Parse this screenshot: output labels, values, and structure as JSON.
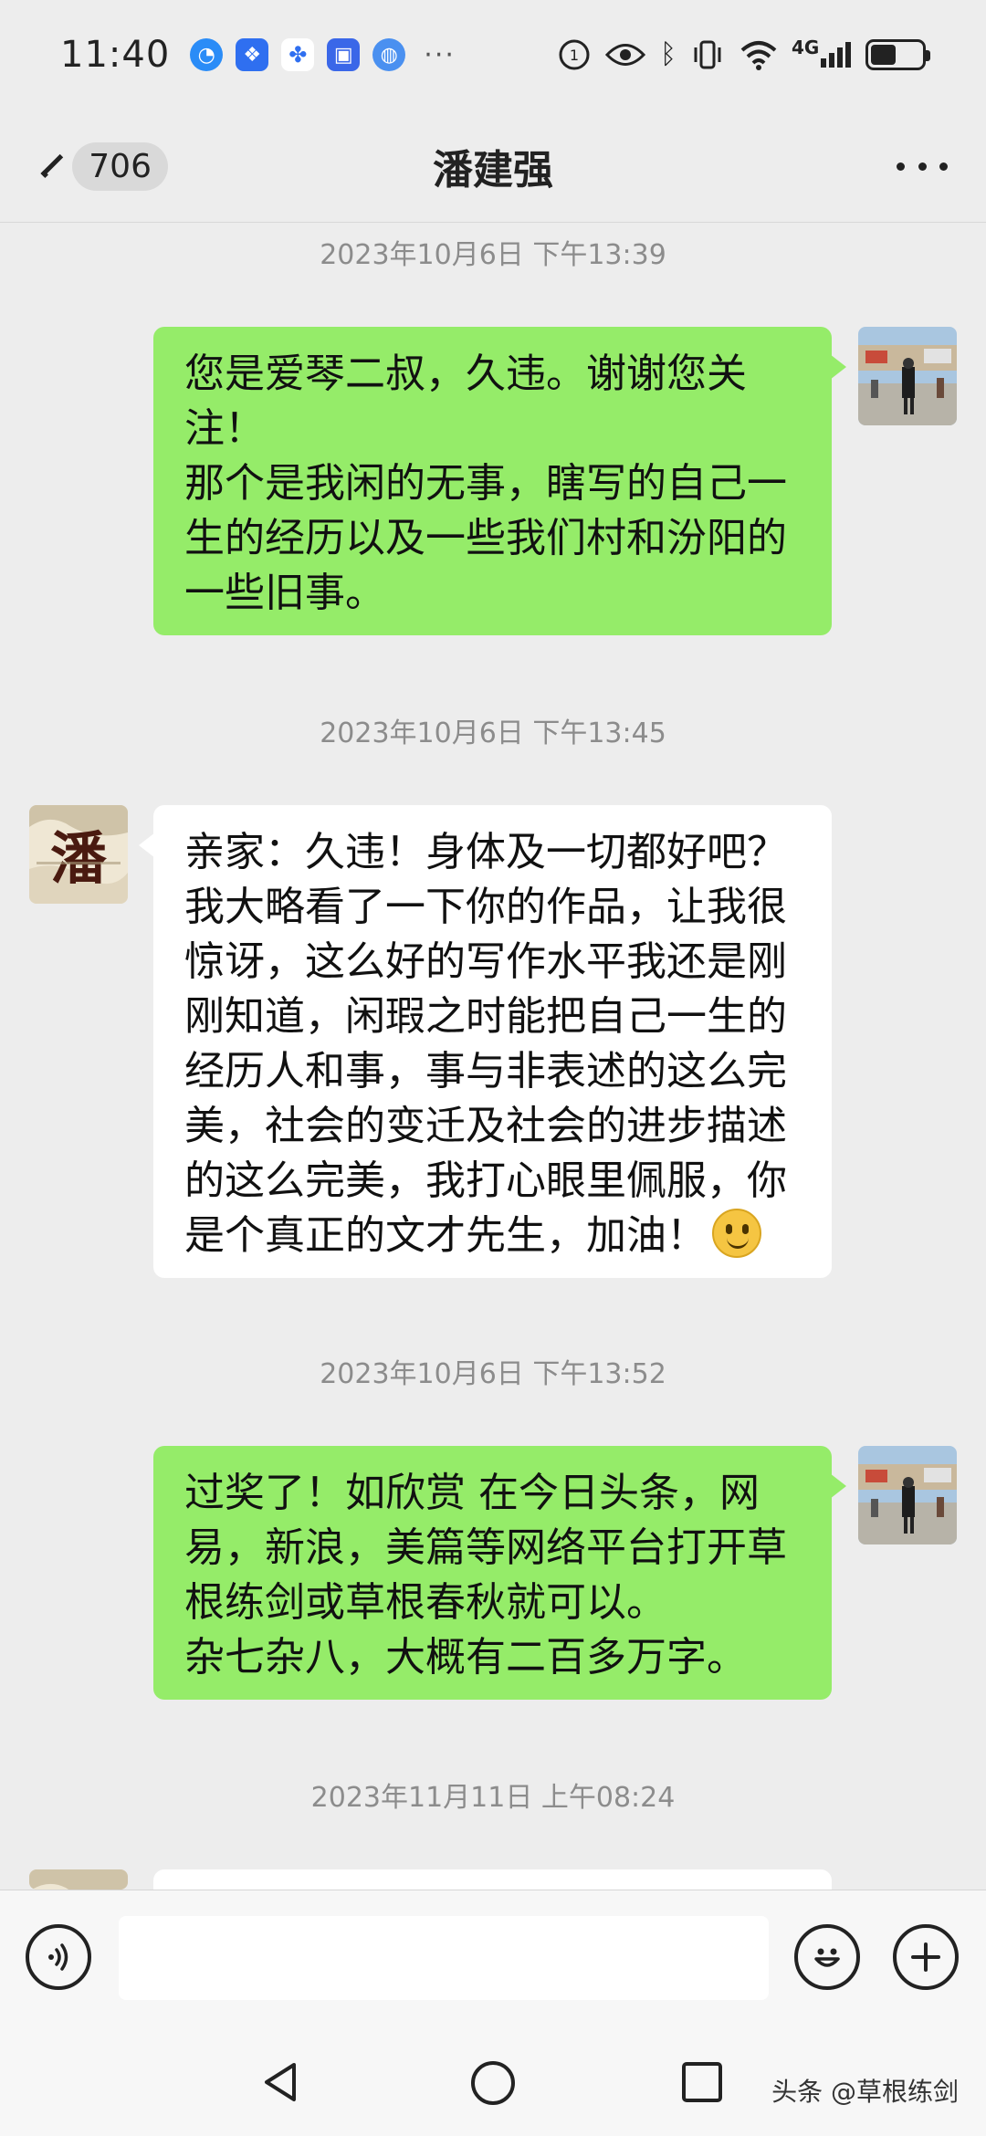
{
  "status_bar": {
    "time": "11:40",
    "network": "4G",
    "more_symbol": "···"
  },
  "header": {
    "unread_count": "706",
    "title": "潘建强"
  },
  "messages": [
    {
      "timestamp": "2023年10月6日 下午13:39",
      "direction": "sent",
      "text": "您是爱琴二叔，久违。谢谢您关\n注！\n那个是我闲的无事，瞎写的自己一\n生的经历以及一些我们村和汾阳的\n一些旧事。"
    },
    {
      "timestamp": "2023年10月6日 下午13:45",
      "direction": "received",
      "text": "亲家：久违！身体及一切都好吧？\n我大略看了一下你的作品，让我很\n惊讶，这么好的写作水平我还是刚\n刚知道，闲瑕之时能把自己一生的\n经历人和事，事与非表述的这么完\n美，社会的变迁及社会的进步描述\n的这么完美，我打心眼里佩服，你\n是个真正的文才先生，加油！",
      "emoji": "smile-emoji"
    },
    {
      "timestamp": "2023年10月6日 下午13:52",
      "direction": "sent",
      "text": "过奖了！如欣赏 在今日头条，网\n易，新浪，美篇等网络平台打开草\n根练剑或草根春秋就可以。\n杂七杂八，大概有二百多万字。"
    },
    {
      "timestamp": "2023年11月11日 上午08:24",
      "direction": "received",
      "text": ""
    }
  ],
  "contact_avatar": {
    "character": "潘"
  },
  "input": {
    "value": ""
  },
  "watermark": "头条 @草根练剑",
  "colors": {
    "background": "#ededed",
    "sent_bubble": "#95ec69",
    "received_bubble": "#ffffff",
    "timestamp": "#8c8c8c"
  }
}
